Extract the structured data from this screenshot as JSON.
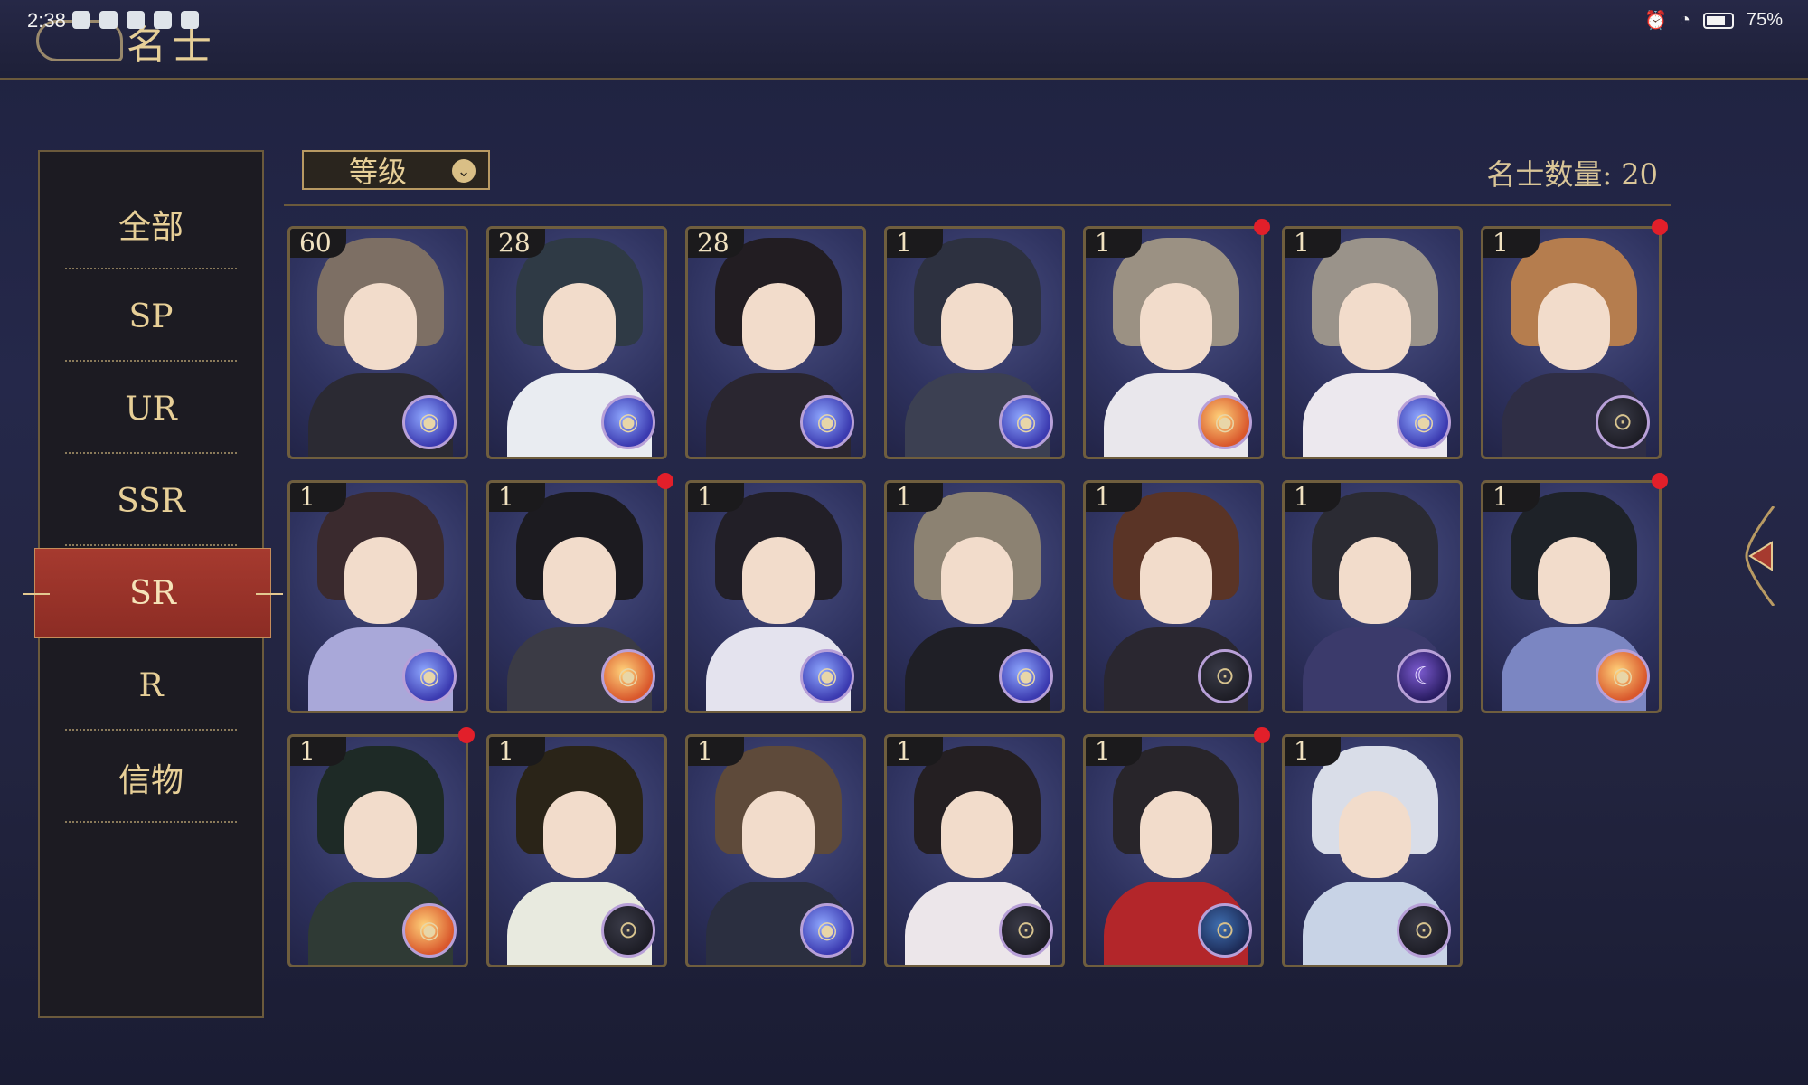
{
  "status_bar": {
    "time": "2:38",
    "battery": "75%"
  },
  "header": {
    "title": "名士"
  },
  "filter": {
    "label": "等级"
  },
  "count_label": "名士数量: 20",
  "tabs": [
    {
      "label": "全部"
    },
    {
      "label": "SP"
    },
    {
      "label": "UR"
    },
    {
      "label": "SSR"
    },
    {
      "label": "SR",
      "active": true
    },
    {
      "label": "R"
    },
    {
      "label": "信物"
    }
  ],
  "cards": [
    {
      "level": "60",
      "element": "blue-orb",
      "new": false
    },
    {
      "level": "28",
      "element": "blue-orb",
      "new": false
    },
    {
      "level": "28",
      "element": "blue-orb",
      "new": false
    },
    {
      "level": "1",
      "element": "blue-orb",
      "new": false
    },
    {
      "level": "1",
      "element": "orange-orb",
      "new": true
    },
    {
      "level": "1",
      "element": "blue-orb",
      "new": false
    },
    {
      "level": "1",
      "element": "compass",
      "new": true
    },
    {
      "level": "1",
      "element": "blue-orb",
      "new": false
    },
    {
      "level": "1",
      "element": "orange-orb",
      "new": true
    },
    {
      "level": "1",
      "element": "blue-orb",
      "new": false
    },
    {
      "level": "1",
      "element": "blue-orb",
      "new": false
    },
    {
      "level": "1",
      "element": "compass",
      "new": false
    },
    {
      "level": "1",
      "element": "moon",
      "new": false
    },
    {
      "level": "1",
      "element": "orange-orb",
      "new": true
    },
    {
      "level": "1",
      "element": "orange-orb",
      "new": true
    },
    {
      "level": "1",
      "element": "compass",
      "new": false
    },
    {
      "level": "1",
      "element": "blue-orb",
      "new": false
    },
    {
      "level": "1",
      "element": "compass",
      "new": false
    },
    {
      "level": "1",
      "element": "navy-compass",
      "new": true
    },
    {
      "level": "1",
      "element": "compass",
      "new": false
    }
  ]
}
